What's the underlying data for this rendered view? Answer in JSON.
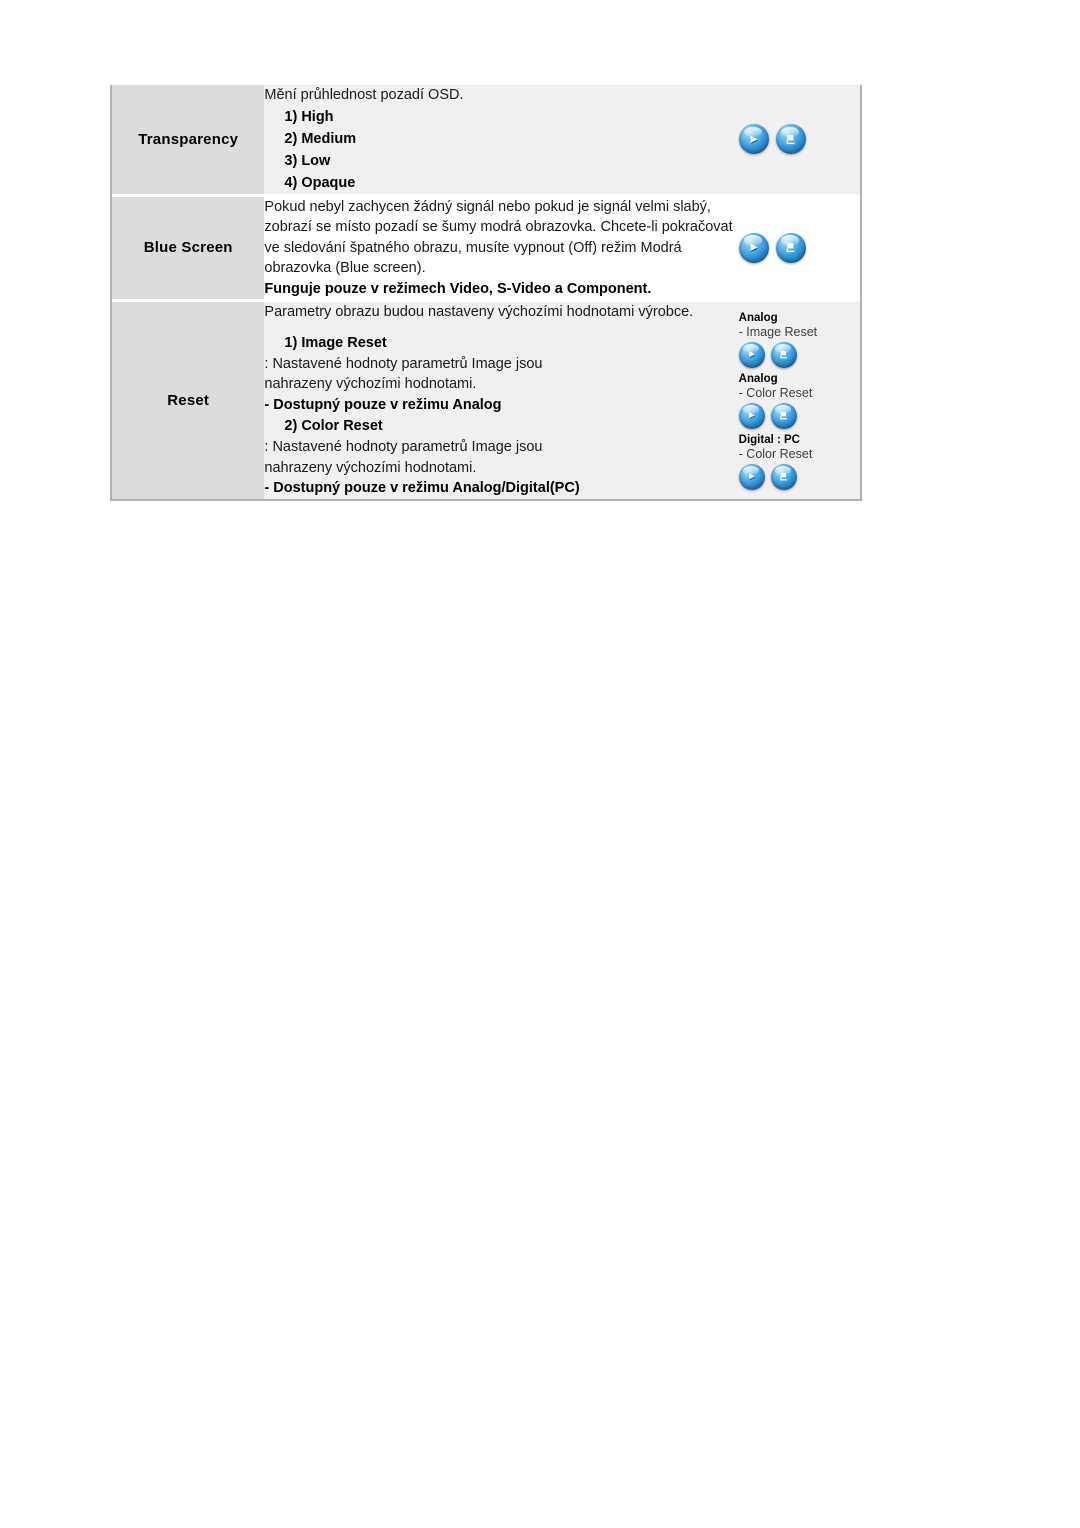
{
  "document": {
    "language": "cs",
    "table_caption": "OSD menu reference table"
  },
  "colors": {
    "label_cell_bg": "#dcdcdc",
    "shaded_cell_bg": "#f0f0f0",
    "plain_cell_bg": "#ffffff",
    "table_border": "#b0b0b0",
    "button_blue": "#2b8fd4",
    "text": "#1a1a1a"
  },
  "rows": [
    {
      "label": "Transparency",
      "shaded": true,
      "intro": "Mění průhlednost pozadí OSD.",
      "options": [
        "1) High",
        "2) Medium",
        "3) Low",
        "4) Opaque"
      ],
      "icons": {
        "style": "large",
        "buttons": [
          {
            "name": "enter-button",
            "glyph": "play-triangle"
          },
          {
            "name": "return-button",
            "glyph": "return-arrow"
          }
        ]
      }
    },
    {
      "label": "Blue Screen",
      "shaded": false,
      "paragraph": "Pokud nebyl zachycen žádný signál nebo pokud je signál velmi slabý, zobrazí se místo pozadí se šumy modrá obrazovka. Chcete-li pokračovat ve sledování špatného obrazu, musíte vypnout (Off) režim Modrá obrazovka (Blue screen).",
      "note": "Funguje pouze v režimech Video, S-Video a Component.",
      "icons": {
        "style": "large",
        "buttons": [
          {
            "name": "enter-button",
            "glyph": "play-triangle"
          },
          {
            "name": "return-button",
            "glyph": "return-arrow"
          }
        ]
      }
    },
    {
      "label": "Reset",
      "shaded": true,
      "paragraph": "Parametry obrazu budou nastaveny výchozími hodnotami výrobce.",
      "items": [
        {
          "heading": "1) Image Reset",
          "body_line1": ": Nastavené hodnoty parametrů Image jsou",
          "body_line2": "nahrazeny výchozími hodnotami.",
          "note": "- Dostupný pouze v režimu Analog"
        },
        {
          "heading": "2) Color Reset",
          "body_line1": ": Nastavené hodnoty parametrů Image jsou",
          "body_line2": "nahrazeny výchozími hodnotami.",
          "note": "- Dostupný pouze v režimu Analog/Digital(PC)"
        }
      ],
      "icon_groups": [
        {
          "title": "Analog",
          "subtitle": "- Image Reset",
          "buttons": [
            {
              "name": "enter-button",
              "glyph": "play-triangle"
            },
            {
              "name": "return-button",
              "glyph": "return-arrow"
            }
          ]
        },
        {
          "title": "Analog",
          "subtitle": "- Color Reset",
          "buttons": [
            {
              "name": "enter-button",
              "glyph": "play-triangle"
            },
            {
              "name": "return-button",
              "glyph": "return-arrow"
            }
          ]
        },
        {
          "title": "Digital : PC",
          "subtitle": "- Color Reset",
          "buttons": [
            {
              "name": "enter-button",
              "glyph": "play-triangle"
            },
            {
              "name": "return-button",
              "glyph": "return-arrow"
            }
          ]
        }
      ]
    }
  ]
}
